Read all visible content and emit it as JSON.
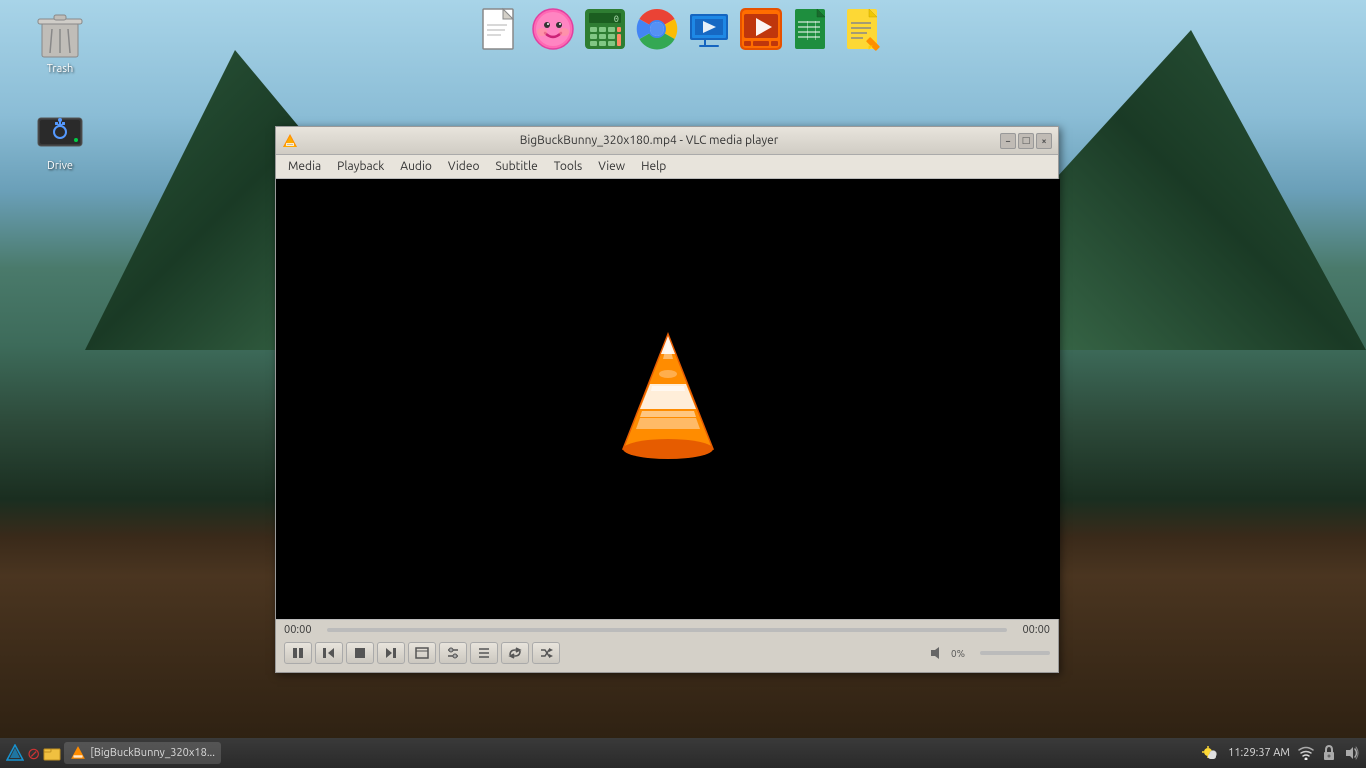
{
  "desktop": {
    "background_description": "Mountain bridge landscape"
  },
  "top_icons": [
    {
      "name": "new-file",
      "label": "New File",
      "symbol": "📄"
    },
    {
      "name": "smile",
      "label": "Smile",
      "symbol": "😊"
    },
    {
      "name": "calculator",
      "label": "Calculator",
      "symbol": "🧮"
    },
    {
      "name": "chrome",
      "label": "Google Chrome",
      "symbol": "chrome"
    },
    {
      "name": "presentation",
      "label": "Presentation",
      "symbol": "🖥"
    },
    {
      "name": "video-player",
      "label": "Video Player",
      "symbol": "▶"
    },
    {
      "name": "sheets",
      "label": "Sheets",
      "symbol": "📊"
    },
    {
      "name": "notes",
      "label": "Notes",
      "symbol": "📝"
    }
  ],
  "desktop_icons": [
    {
      "id": "trash",
      "label": "Trash",
      "symbol": "trash"
    },
    {
      "id": "drive",
      "label": "Drive",
      "symbol": "drive"
    }
  ],
  "vlc": {
    "title": "BigBuckBunny_320x180.mp4 - VLC media player",
    "menu_items": [
      "Media",
      "Playback",
      "Audio",
      "Video",
      "Subtitle",
      "Tools",
      "View",
      "Help"
    ],
    "time_current": "00:00",
    "time_total": "00:00",
    "volume_label": "0%",
    "controls": {
      "pause": "⏸",
      "prev": "⏮",
      "stop": "⏹",
      "next": "⏭",
      "fullscreen": "⛶",
      "extended": "⧉",
      "playlist": "☰",
      "loop": "↺",
      "random": "⤮"
    },
    "window_controls": {
      "minimize": "−",
      "maximize": "□",
      "close": "×"
    }
  },
  "taskbar": {
    "app_button_label": "[BigBuckBunny_320x18...",
    "time": "11:29:37 AM",
    "icons": {
      "wifi": "wifi",
      "lock": "lock",
      "sound": "sound",
      "weather": "weather"
    }
  }
}
